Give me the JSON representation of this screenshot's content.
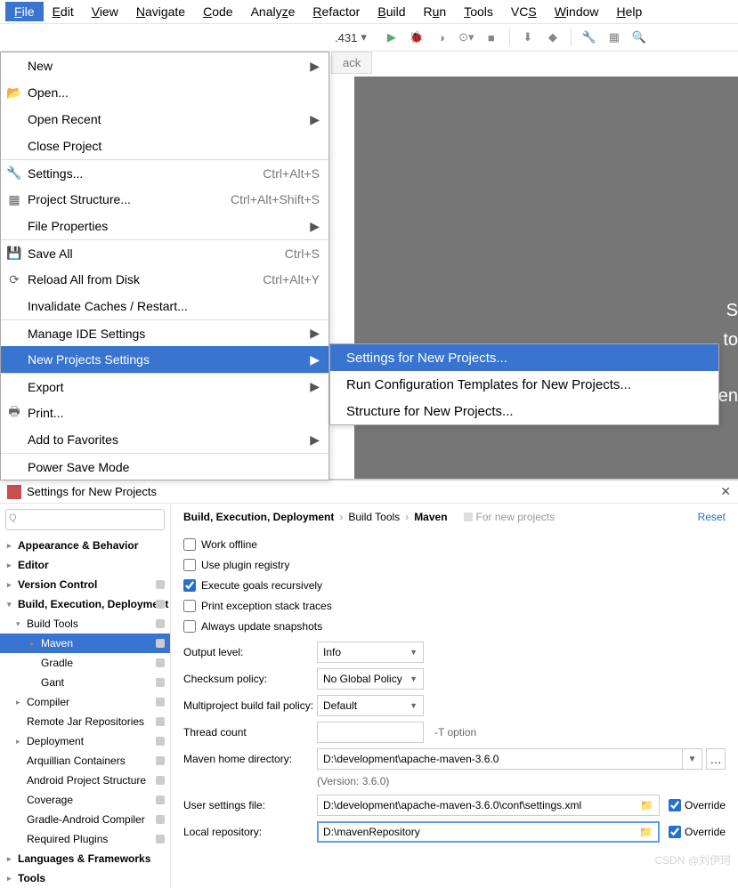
{
  "menubar": [
    "File",
    "Edit",
    "View",
    "Navigate",
    "Code",
    "Analyze",
    "Refactor",
    "Build",
    "Run",
    "Tools",
    "VCS",
    "Window",
    "Help"
  ],
  "toolbar": {
    "text": ".431"
  },
  "file_menu": {
    "items": [
      {
        "label": "New",
        "arrow": true
      },
      {
        "label": "Open...",
        "icon": "📂"
      },
      {
        "label": "Open Recent",
        "arrow": true
      },
      {
        "label": "Close Project"
      },
      {
        "label": "Settings...",
        "icon": "🔧",
        "shortcut": "Ctrl+Alt+S",
        "sep": true
      },
      {
        "label": "Project Structure...",
        "icon": "▦",
        "shortcut": "Ctrl+Alt+Shift+S"
      },
      {
        "label": "File Properties",
        "arrow": true
      },
      {
        "label": "Save All",
        "icon": "💾",
        "shortcut": "Ctrl+S",
        "sep": true
      },
      {
        "label": "Reload All from Disk",
        "icon": "⟳",
        "shortcut": "Ctrl+Alt+Y"
      },
      {
        "label": "Invalidate Caches / Restart..."
      },
      {
        "label": "Manage IDE Settings",
        "arrow": true,
        "sep": true
      },
      {
        "label": "New Projects Settings",
        "arrow": true,
        "hl": true
      },
      {
        "label": "Export",
        "arrow": true,
        "sep": true
      },
      {
        "label": "Print...",
        "icon": "🖶"
      },
      {
        "label": "Add to Favorites",
        "arrow": true
      },
      {
        "label": "Power Save Mode",
        "sep": true
      }
    ]
  },
  "submenu": {
    "items": [
      {
        "label": "Settings for New Projects...",
        "hl": true
      },
      {
        "label": "Run Configuration Templates for New Projects..."
      },
      {
        "label": "Structure for New Projects..."
      }
    ]
  },
  "editor": {
    "tab": "ack",
    "hints": [
      "S",
      "to",
      "Recen"
    ]
  },
  "settings": {
    "title": "Settings for New Projects",
    "search_placeholder": "",
    "breadcrumb": {
      "a": "Build, Execution, Deployment",
      "b": "Build Tools",
      "c": "Maven",
      "badge": "For new projects",
      "reset": "Reset"
    },
    "tree": [
      {
        "label": "Appearance & Behavior",
        "bold": true,
        "caret": ">"
      },
      {
        "label": "Editor",
        "bold": true,
        "caret": ">"
      },
      {
        "label": "Version Control",
        "bold": true,
        "caret": ">",
        "tag": true
      },
      {
        "label": "Build, Execution, Deployment",
        "bold": true,
        "caret": "v",
        "tag": true
      },
      {
        "label": "Build Tools",
        "lvl": 1,
        "caret": "v",
        "tag": true
      },
      {
        "label": "Maven",
        "lvl": 2,
        "caret": ">",
        "hl": true,
        "tag": true
      },
      {
        "label": "Gradle",
        "lvl": 2,
        "tag": true
      },
      {
        "label": "Gant",
        "lvl": 2,
        "tag": true
      },
      {
        "label": "Compiler",
        "lvl": 1,
        "caret": ">",
        "tag": true
      },
      {
        "label": "Remote Jar Repositories",
        "lvl": 1,
        "tag": true
      },
      {
        "label": "Deployment",
        "lvl": 1,
        "caret": ">",
        "tag": true
      },
      {
        "label": "Arquillian Containers",
        "lvl": 1,
        "tag": true
      },
      {
        "label": "Android Project Structure",
        "lvl": 1,
        "tag": true
      },
      {
        "label": "Coverage",
        "lvl": 1,
        "tag": true
      },
      {
        "label": "Gradle-Android Compiler",
        "lvl": 1,
        "tag": true
      },
      {
        "label": "Required Plugins",
        "lvl": 1,
        "tag": true
      },
      {
        "label": "Languages & Frameworks",
        "bold": true,
        "caret": ">"
      },
      {
        "label": "Tools",
        "bold": true,
        "caret": ">"
      }
    ],
    "checks": {
      "work_offline": "Work offline",
      "use_plugin": "Use plugin registry",
      "exec_recursive": "Execute goals recursively",
      "print_exc": "Print exception stack traces",
      "always_update": "Always update snapshots"
    },
    "labels": {
      "output": "Output level:",
      "checksum": "Checksum policy:",
      "multi": "Multiproject build fail policy:",
      "thread": "Thread count",
      "thread_hint": "-T option",
      "home": "Maven home directory:",
      "version": "(Version: 3.6.0)",
      "user_file": "User settings file:",
      "local_repo": "Local repository:",
      "override": "Override"
    },
    "values": {
      "output": "Info",
      "checksum": "No Global Policy",
      "multi": "Default",
      "home": "D:\\development\\apache-maven-3.6.0",
      "user_file": "D:\\development\\apache-maven-3.6.0\\conf\\settings.xml",
      "local_repo": "D:\\mavenRepository"
    }
  },
  "watermark": "CSDN @刘伊珂"
}
